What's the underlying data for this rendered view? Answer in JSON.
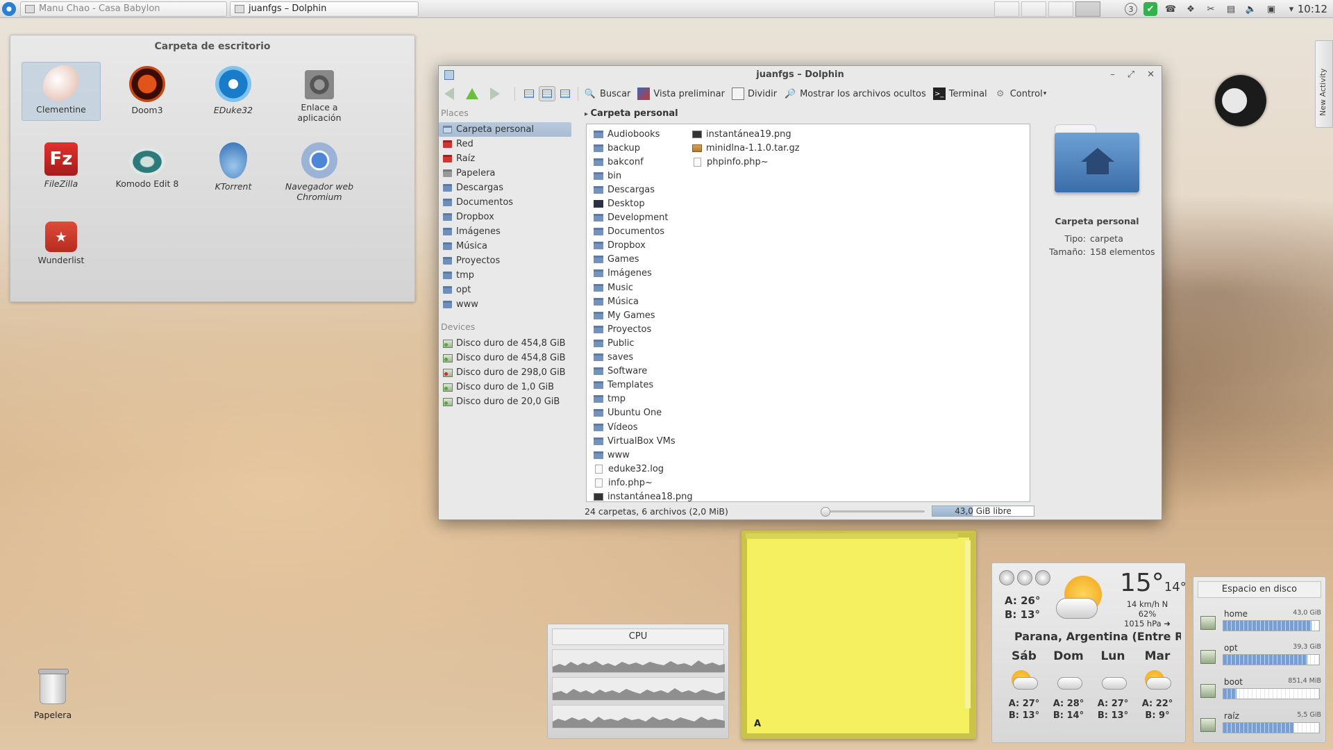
{
  "panel": {
    "tasks": [
      {
        "label": "Manu Chao - Casa Babylon",
        "active": false
      },
      {
        "label": "juanfgs – Dolphin",
        "active": true
      }
    ],
    "tray_badge": "3",
    "clock": "10:12"
  },
  "folderview": {
    "title": "Carpeta de escritorio",
    "items": [
      {
        "label": "Clementine",
        "italic": false
      },
      {
        "label": "Doom3",
        "italic": false
      },
      {
        "label": "EDuke32",
        "italic": true
      },
      {
        "label": "Enlace a aplicación",
        "italic": false
      },
      {
        "label": "FileZilla",
        "italic": true
      },
      {
        "label": "Komodo Edit 8",
        "italic": false
      },
      {
        "label": "KTorrent",
        "italic": true
      },
      {
        "label": "Navegador web Chromium",
        "italic": true
      },
      {
        "label": "Wunderlist",
        "italic": false
      }
    ]
  },
  "dolphin": {
    "title": "juanfgs – Dolphin",
    "toolbar": {
      "search": "Buscar",
      "preview": "Vista preliminar",
      "split": "Dividir",
      "hidden": "Mostrar los archivos ocultos",
      "terminal": "Terminal",
      "control": "Control"
    },
    "places_header": "Places",
    "places": [
      "Carpeta personal",
      "Red",
      "Raíz",
      "Papelera",
      "Descargas",
      "Documentos",
      "Dropbox",
      "Imágenes",
      "Música",
      "Proyectos",
      "tmp",
      "opt",
      "www"
    ],
    "devices_header": "Devices",
    "devices": [
      "Disco duro de 454,8 GiB",
      "Disco duro de 454,8 GiB",
      "Disco duro de 298,0 GiB",
      "Disco duro de 1,0 GiB",
      "Disco duro de 20,0 GiB"
    ],
    "breadcrumb": "Carpeta personal",
    "files_col1": [
      {
        "name": "Audiobooks",
        "type": "folder"
      },
      {
        "name": "backup",
        "type": "folder"
      },
      {
        "name": "bakconf",
        "type": "folder"
      },
      {
        "name": "bin",
        "type": "folder"
      },
      {
        "name": "Descargas",
        "type": "folder"
      },
      {
        "name": "Desktop",
        "type": "desktop"
      },
      {
        "name": "Development",
        "type": "folder"
      },
      {
        "name": "Documentos",
        "type": "folder"
      },
      {
        "name": "Dropbox",
        "type": "folder"
      },
      {
        "name": "Games",
        "type": "folder"
      },
      {
        "name": "Imágenes",
        "type": "folder"
      },
      {
        "name": "Music",
        "type": "folder"
      },
      {
        "name": "Música",
        "type": "folder"
      },
      {
        "name": "My Games",
        "type": "folder"
      },
      {
        "name": "Proyectos",
        "type": "folder"
      },
      {
        "name": "Public",
        "type": "folder"
      },
      {
        "name": "saves",
        "type": "folder"
      },
      {
        "name": "Software",
        "type": "folder"
      },
      {
        "name": "Templates",
        "type": "folder"
      },
      {
        "name": "tmp",
        "type": "folder"
      },
      {
        "name": "Ubuntu One",
        "type": "folder"
      },
      {
        "name": "Vídeos",
        "type": "folder"
      },
      {
        "name": "VirtualBox VMs",
        "type": "folder"
      },
      {
        "name": "www",
        "type": "folder"
      },
      {
        "name": "eduke32.log",
        "type": "doc"
      },
      {
        "name": "info.php~",
        "type": "doc"
      },
      {
        "name": "instantánea18.png",
        "type": "image"
      }
    ],
    "files_col2": [
      {
        "name": "instantánea19.png",
        "type": "image"
      },
      {
        "name": "minidlna-1.1.0.tar.gz",
        "type": "archive"
      },
      {
        "name": "phpinfo.php~",
        "type": "doc"
      }
    ],
    "info": {
      "name": "Carpeta personal",
      "type_label": "Tipo:",
      "type_value": "carpeta",
      "size_label": "Tamaño:",
      "size_value": "158 elementos"
    },
    "status": "24 carpetas, 6 archivos (2,0 MiB)",
    "free_space": "43,0 GiB libre",
    "free_fill": 0.4
  },
  "cpu": {
    "title": "CPU"
  },
  "weather": {
    "high": "A: 26°",
    "low": "B: 13°",
    "temp": "15°",
    "temp_small": "14°",
    "wind": "14 km/h N",
    "humidity": "62%",
    "pressure": "1015 hPa ➜",
    "location": "Parana, Argentina (Entre Ri...",
    "days": [
      {
        "name": "Sáb",
        "icon": "sun-cloud",
        "high": "A: 27°",
        "low": "B: 13°"
      },
      {
        "name": "Dom",
        "icon": "cloud",
        "high": "A: 28°",
        "low": "B: 14°"
      },
      {
        "name": "Lun",
        "icon": "cloud",
        "high": "A: 27°",
        "low": "B: 13°"
      },
      {
        "name": "Mar",
        "icon": "sun-cloud",
        "high": "A: 22°",
        "low": "B: 9°"
      }
    ]
  },
  "disk": {
    "title": "Espacio en disco",
    "rows": [
      {
        "name": "home",
        "size": "43,0 GiB",
        "used": 0.92
      },
      {
        "name": "opt",
        "size": "39,3 GiB",
        "used": 0.88
      },
      {
        "name": "boot",
        "size": "851,4 MiB",
        "used": 0.14
      },
      {
        "name": "raíz",
        "size": "5,5 GiB",
        "used": 0.74
      }
    ]
  },
  "activity": {
    "label": "New Activity"
  },
  "trash": {
    "label": "Papelera"
  }
}
